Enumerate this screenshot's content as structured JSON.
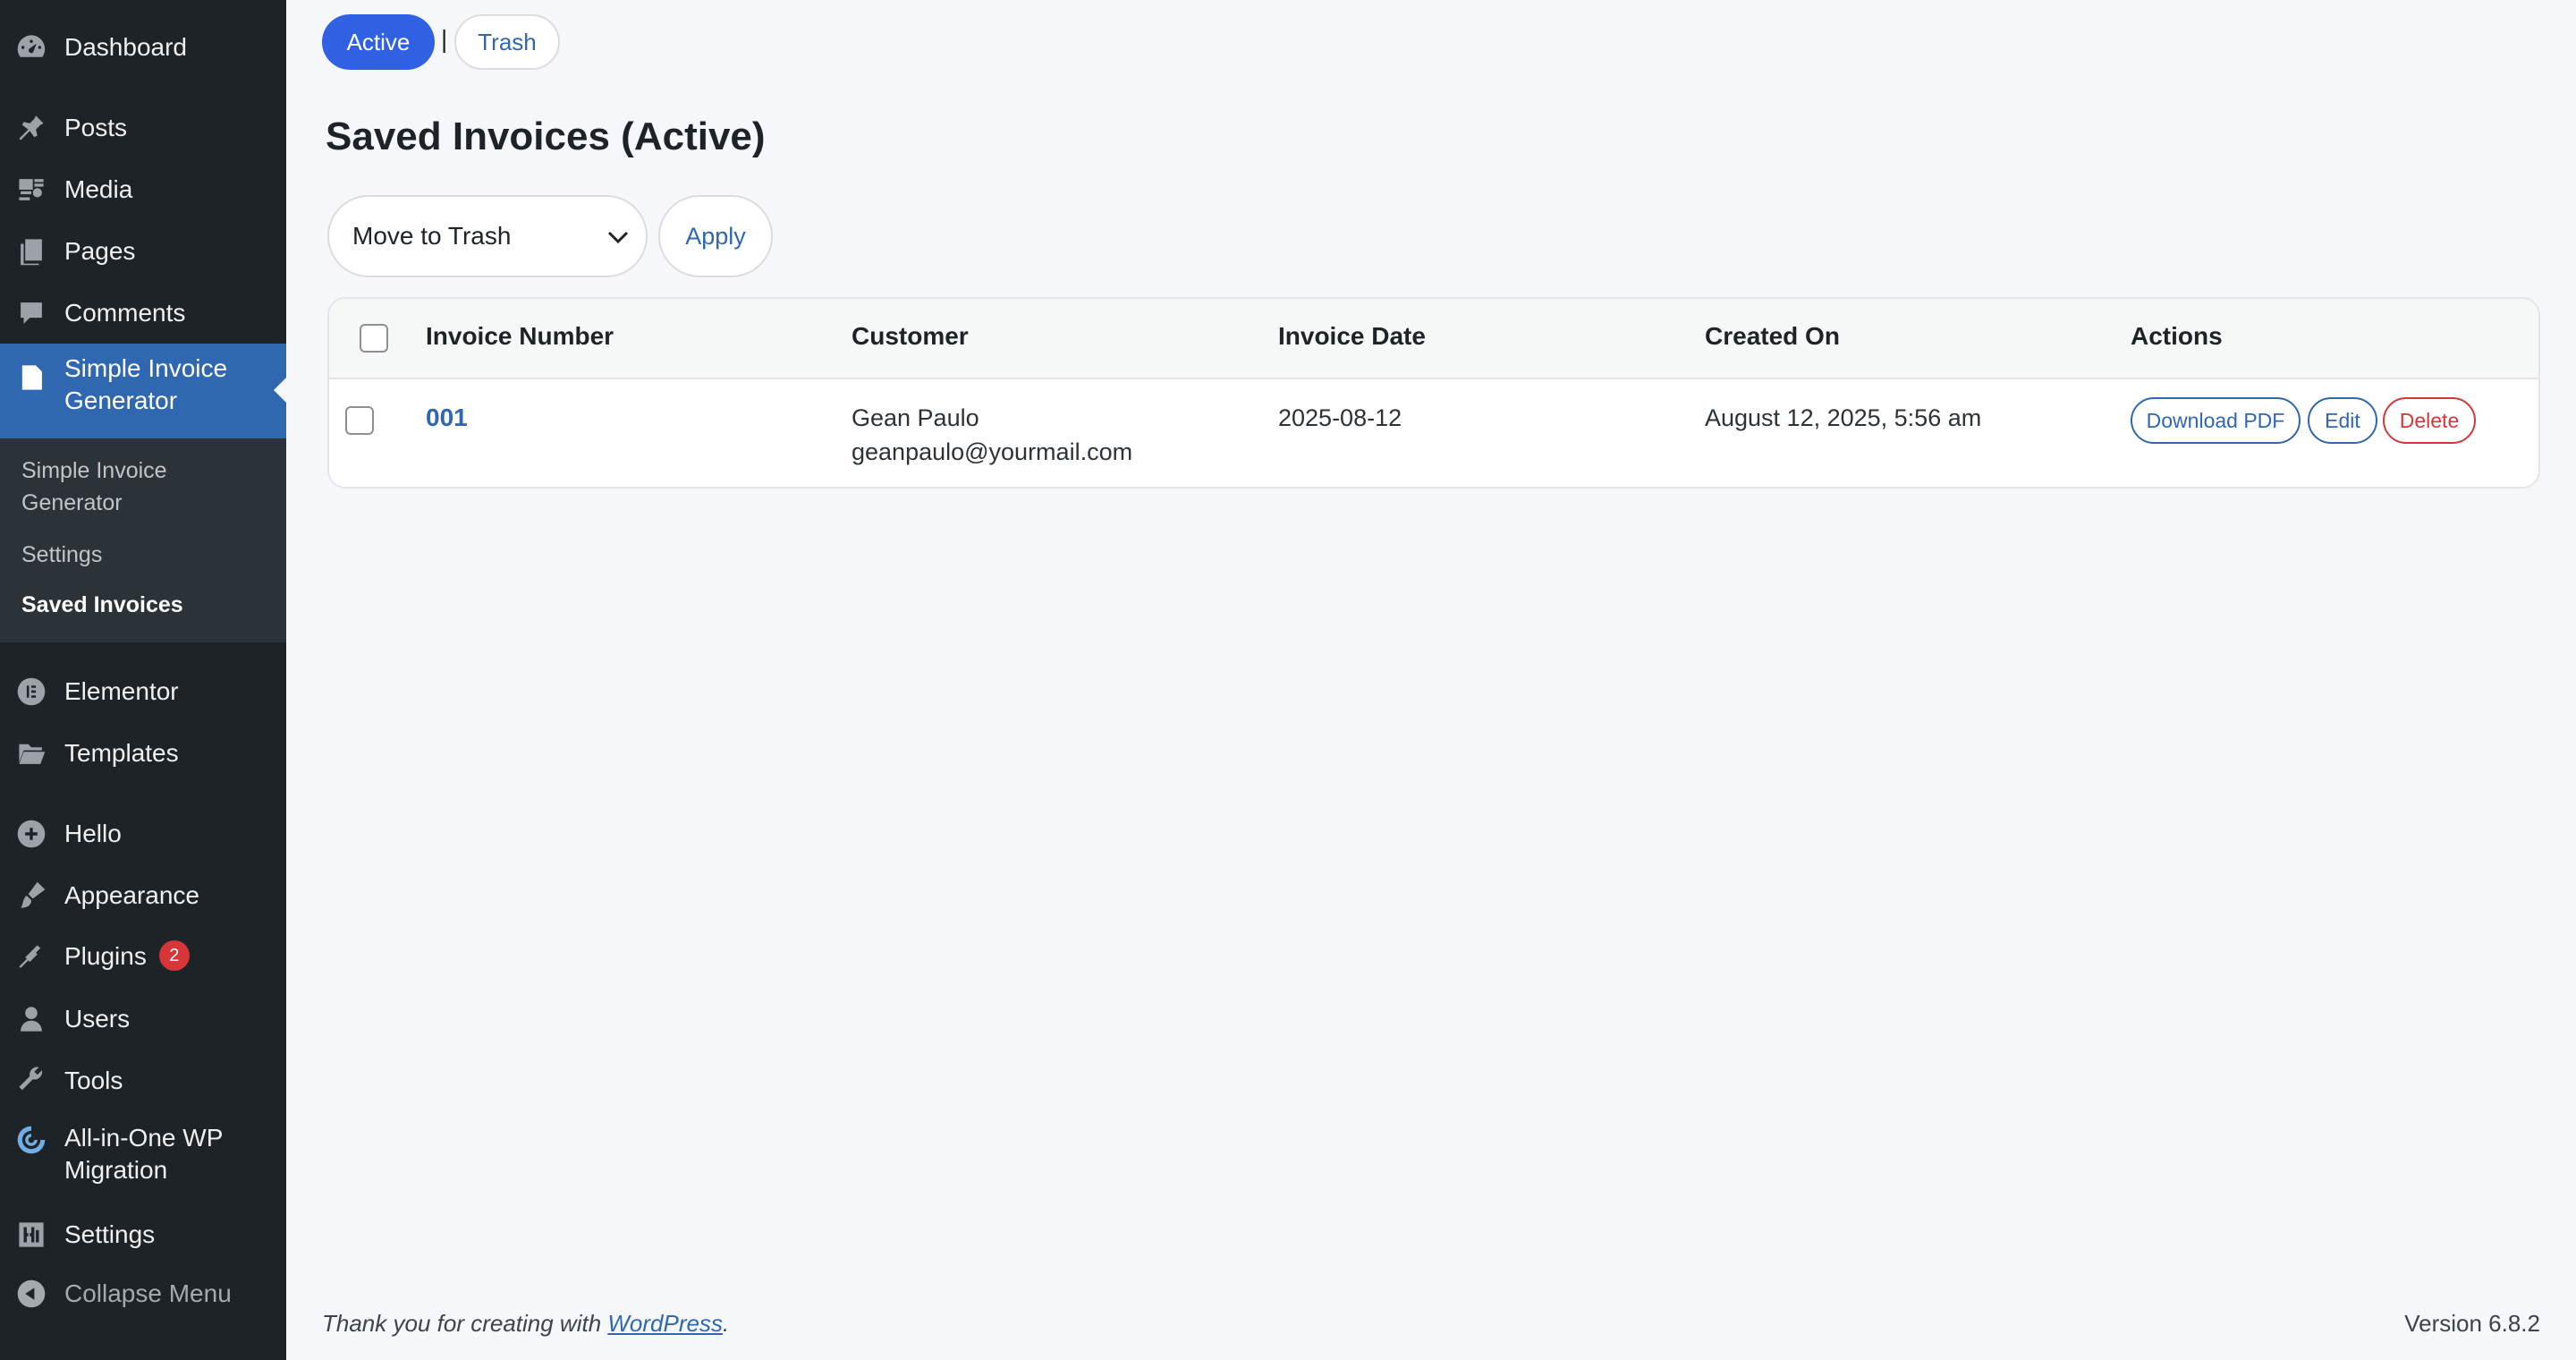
{
  "sidebar": {
    "items": [
      {
        "label": "Dashboard",
        "icon": "dashboard-icon"
      },
      {
        "label": "Posts",
        "icon": "pin-icon"
      },
      {
        "label": "Media",
        "icon": "media-icon"
      },
      {
        "label": "Pages",
        "icon": "pages-icon"
      },
      {
        "label": "Comments",
        "icon": "comment-icon"
      },
      {
        "label": "Simple Invoice Generator",
        "icon": "document-icon"
      },
      {
        "label": "Elementor",
        "icon": "elementor-icon"
      },
      {
        "label": "Templates",
        "icon": "folder-icon"
      },
      {
        "label": "Hello",
        "icon": "plus-circle-icon"
      },
      {
        "label": "Appearance",
        "icon": "brush-icon"
      },
      {
        "label": "Plugins",
        "icon": "plug-icon",
        "badge": "2"
      },
      {
        "label": "Users",
        "icon": "user-icon"
      },
      {
        "label": "Tools",
        "icon": "wrench-icon"
      },
      {
        "label": "All-in-One WP Migration",
        "icon": "migration-icon"
      },
      {
        "label": "Settings",
        "icon": "sliders-icon"
      }
    ],
    "submenu": [
      {
        "label": "Simple Invoice Generator"
      },
      {
        "label": "Settings"
      },
      {
        "label": "Saved Invoices"
      }
    ],
    "collapse_label": "Collapse Menu"
  },
  "tabs": {
    "active_label": "Active",
    "separator": "|",
    "trash_label": "Trash"
  },
  "page_title": "Saved Invoices (Active)",
  "bulk_actions": {
    "selected": "Move to Trash",
    "apply_label": "Apply"
  },
  "table": {
    "headers": [
      "Invoice Number",
      "Customer",
      "Invoice Date",
      "Created On",
      "Actions"
    ],
    "rows": [
      {
        "invoice_number": "001",
        "customer_name": "Gean Paulo",
        "customer_email": "geanpaulo@yourmail.com",
        "invoice_date": "2025-08-12",
        "created_on": "August 12, 2025, 5:56 am",
        "actions": [
          "Download PDF",
          "Edit",
          "Delete"
        ]
      }
    ]
  },
  "footer": {
    "thanks_prefix": "Thank you for creating with ",
    "thanks_link": "WordPress",
    "thanks_suffix": ".",
    "version": "Version 6.8.2"
  },
  "colors": {
    "sidebar_bg": "#1d2327",
    "sidebar_active": "#2f67b1",
    "accent_blue": "#3061e3",
    "link_blue": "#2f67b1",
    "danger_red": "#d63638",
    "page_bg": "#f6f7fb"
  }
}
